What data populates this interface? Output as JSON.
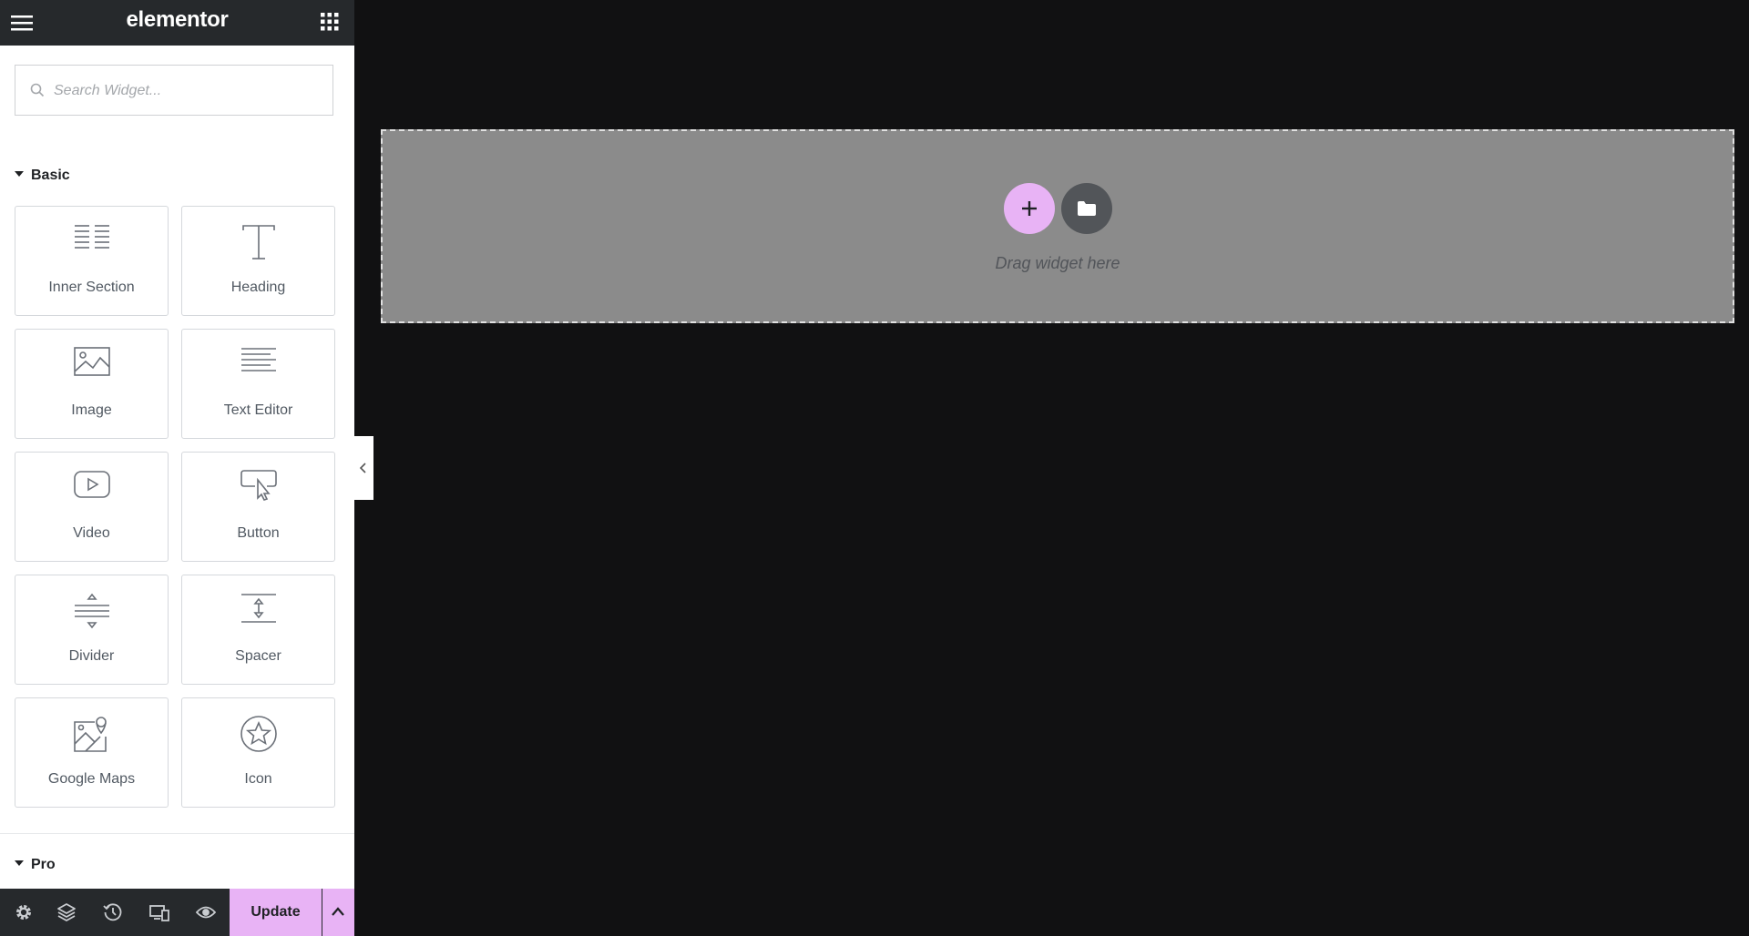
{
  "header": {
    "logo": "elementor"
  },
  "search": {
    "placeholder": "Search Widget..."
  },
  "categories": {
    "basic": "Basic",
    "pro": "Pro"
  },
  "widgets": [
    {
      "label": "Inner Section",
      "icon": "inner-section-icon"
    },
    {
      "label": "Heading",
      "icon": "heading-icon"
    },
    {
      "label": "Image",
      "icon": "image-icon"
    },
    {
      "label": "Text Editor",
      "icon": "text-editor-icon"
    },
    {
      "label": "Video",
      "icon": "video-icon"
    },
    {
      "label": "Button",
      "icon": "button-icon"
    },
    {
      "label": "Divider",
      "icon": "divider-icon"
    },
    {
      "label": "Spacer",
      "icon": "spacer-icon"
    },
    {
      "label": "Google Maps",
      "icon": "google-maps-icon"
    },
    {
      "label": "Icon",
      "icon": "star-icon"
    }
  ],
  "footer": {
    "update_label": "Update",
    "icons": [
      "gear-icon",
      "layers-icon",
      "history-icon",
      "responsive-icon",
      "eye-icon"
    ]
  },
  "canvas": {
    "drop_text": "Drag widget here"
  },
  "colors": {
    "accent": "#e8b3f5",
    "panel_dark": "#26292c",
    "canvas_bg": "#111112",
    "dropzone": "#8b8b8b"
  }
}
